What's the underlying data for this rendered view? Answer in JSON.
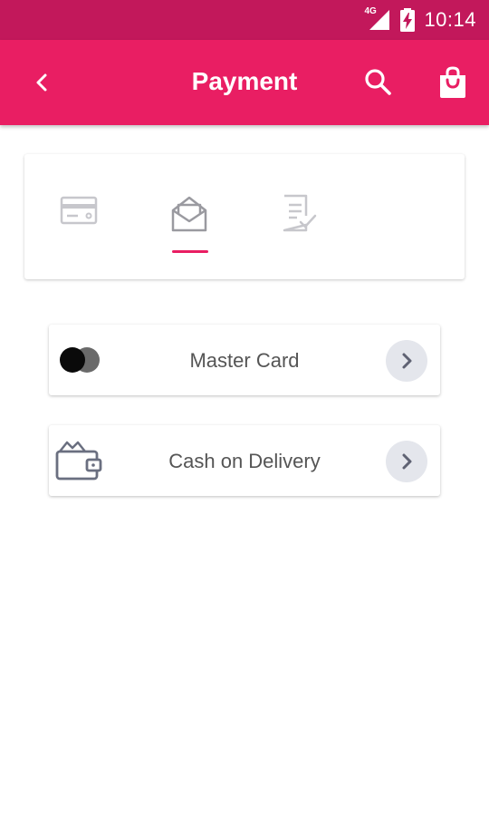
{
  "status_bar": {
    "network": "4G",
    "time": "10:14",
    "icons": [
      "signal-icon",
      "battery-charging-icon"
    ]
  },
  "app_bar": {
    "title": "Payment",
    "icons": [
      "back-arrow-icon",
      "search-icon",
      "shopping-bag-icon"
    ]
  },
  "checkout_steps": {
    "active_step": 2,
    "steps": [
      {
        "icon": "credit-card-icon",
        "active": false
      },
      {
        "icon": "open-envelope-icon",
        "active": true
      },
      {
        "icon": "document-check-icon",
        "active": false
      }
    ]
  },
  "payment_options": [
    {
      "label": "Master Card",
      "icon": "mastercard-icon"
    },
    {
      "label": "Cash on Delivery",
      "icon": "wallet-icon"
    }
  ],
  "colors": {
    "status_bar": "#c2185b",
    "app_bar": "#e91e63",
    "accent": "#e91e63",
    "inactive_icon": "#c7c7cc",
    "chevron_bg": "#e4e6ec"
  }
}
